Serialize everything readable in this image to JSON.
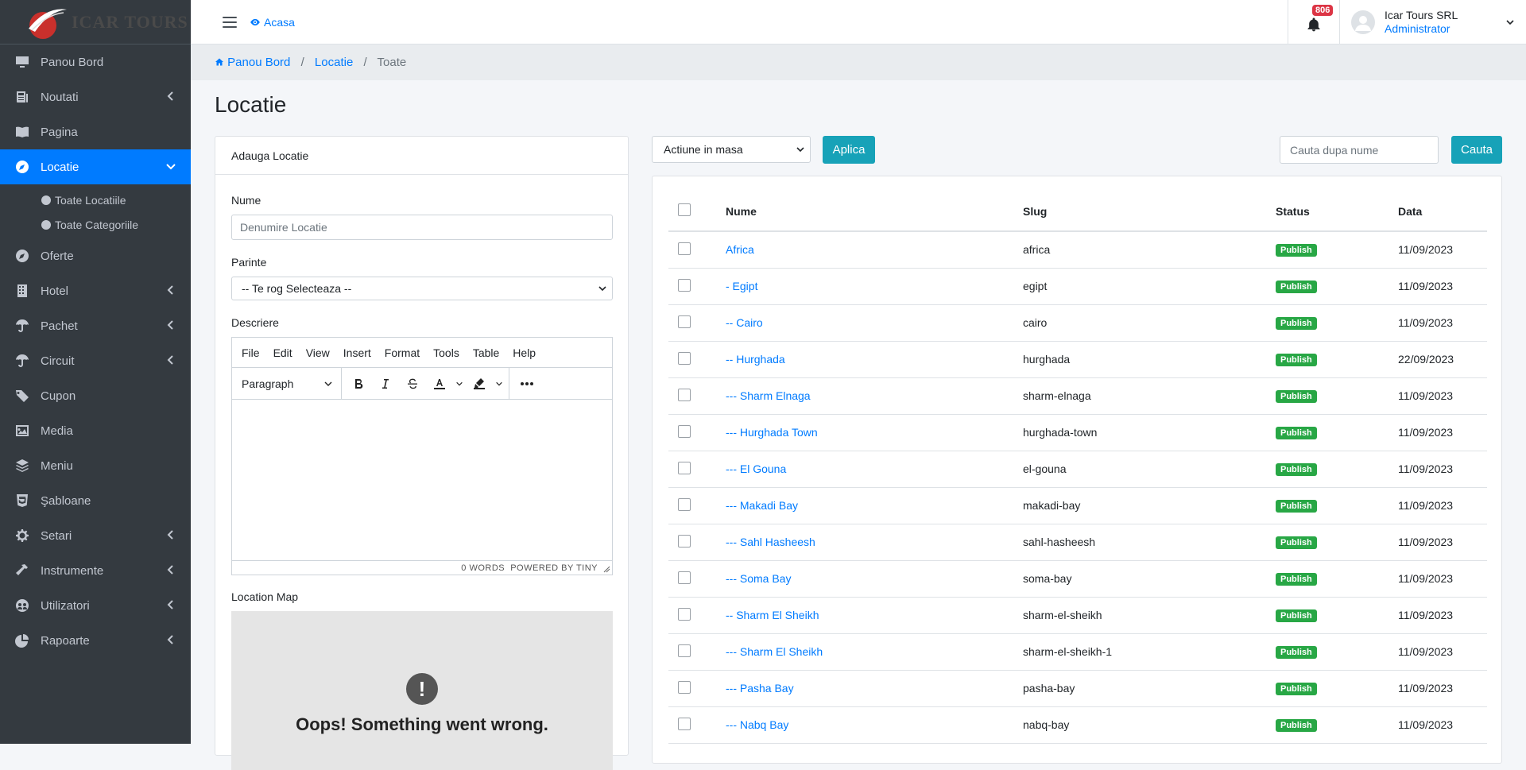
{
  "brand": {
    "name": "ICAR TOURS"
  },
  "sidebar": {
    "items": [
      {
        "label": "Panou Bord",
        "icon": "desktop-icon"
      },
      {
        "label": "Noutati",
        "icon": "newspaper-icon"
      },
      {
        "label": "Pagina",
        "icon": "book-icon"
      },
      {
        "label": "Locatie",
        "icon": "compass-icon"
      },
      {
        "label": "Oferte",
        "icon": "compass-icon"
      },
      {
        "label": "Hotel",
        "icon": "building-icon"
      },
      {
        "label": "Pachet",
        "icon": "umbrella-icon"
      },
      {
        "label": "Circuit",
        "icon": "umbrella-icon"
      },
      {
        "label": "Cupon",
        "icon": "tags-icon"
      },
      {
        "label": "Media",
        "icon": "image-icon"
      },
      {
        "label": "Meniu",
        "icon": "layers-icon"
      },
      {
        "label": "Şabloane",
        "icon": "html5-icon"
      },
      {
        "label": "Setari",
        "icon": "cogs-icon"
      },
      {
        "label": "Instrumente",
        "icon": "hammer-icon"
      },
      {
        "label": "Utilizatori",
        "icon": "users-icon"
      },
      {
        "label": "Rapoarte",
        "icon": "chart-pie-icon"
      }
    ],
    "sub": [
      {
        "label": "Toate Locatiile"
      },
      {
        "label": "Toate Categoriile"
      }
    ]
  },
  "topbar": {
    "home": "Acasa",
    "notifications": "806",
    "user_name": "Icar Tours SRL",
    "user_role": "Administrator"
  },
  "breadcrumb": {
    "home": "Panou Bord",
    "section": "Locatie",
    "current": "Toate"
  },
  "page": {
    "title": "Locatie"
  },
  "form": {
    "header": "Adauga Locatie",
    "name_label": "Nume",
    "name_placeholder": "Denumire Locatie",
    "parent_label": "Parinte",
    "parent_value": "-- Te rog Selecteaza --",
    "desc_label": "Descriere",
    "editor_menu": [
      "File",
      "Edit",
      "View",
      "Insert",
      "Format",
      "Tools",
      "Table",
      "Help"
    ],
    "editor_block": "Paragraph",
    "editor_footer": "0 WORDS  POWERED BY TINY",
    "map_label": "Location Map",
    "map_error": "Oops! Something went wrong."
  },
  "actions": {
    "bulk": "Actiune in masa",
    "apply": "Aplica",
    "search_placeholder": "Cauta dupa nume",
    "search_btn": "Cauta"
  },
  "table": {
    "headers": [
      "Nume",
      "Slug",
      "Status",
      "Data"
    ],
    "rows": [
      {
        "name": "Africa",
        "slug": "africa",
        "status": "Publish",
        "date": "11/09/2023"
      },
      {
        "name": "- Egipt",
        "slug": "egipt",
        "status": "Publish",
        "date": "11/09/2023"
      },
      {
        "name": "-- Cairo",
        "slug": "cairo",
        "status": "Publish",
        "date": "11/09/2023"
      },
      {
        "name": "-- Hurghada",
        "slug": "hurghada",
        "status": "Publish",
        "date": "22/09/2023"
      },
      {
        "name": "--- Sharm Elnaga",
        "slug": "sharm-elnaga",
        "status": "Publish",
        "date": "11/09/2023"
      },
      {
        "name": "--- Hurghada Town",
        "slug": "hurghada-town",
        "status": "Publish",
        "date": "11/09/2023"
      },
      {
        "name": "--- El Gouna",
        "slug": "el-gouna",
        "status": "Publish",
        "date": "11/09/2023"
      },
      {
        "name": "--- Makadi Bay",
        "slug": "makadi-bay",
        "status": "Publish",
        "date": "11/09/2023"
      },
      {
        "name": "--- Sahl Hasheesh",
        "slug": "sahl-hasheesh",
        "status": "Publish",
        "date": "11/09/2023"
      },
      {
        "name": "--- Soma Bay",
        "slug": "soma-bay",
        "status": "Publish",
        "date": "11/09/2023"
      },
      {
        "name": "-- Sharm El Sheikh",
        "slug": "sharm-el-sheikh",
        "status": "Publish",
        "date": "11/09/2023"
      },
      {
        "name": "--- Sharm El Sheikh",
        "slug": "sharm-el-sheikh-1",
        "status": "Publish",
        "date": "11/09/2023"
      },
      {
        "name": "--- Pasha Bay",
        "slug": "pasha-bay",
        "status": "Publish",
        "date": "11/09/2023"
      },
      {
        "name": "--- Nabq Bay",
        "slug": "nabq-bay",
        "status": "Publish",
        "date": "11/09/2023"
      }
    ]
  },
  "colors": {
    "sidebar": "#343a40",
    "active": "#007bff",
    "info": "#17a2b8",
    "success": "#28a745",
    "danger": "#dc3545"
  }
}
